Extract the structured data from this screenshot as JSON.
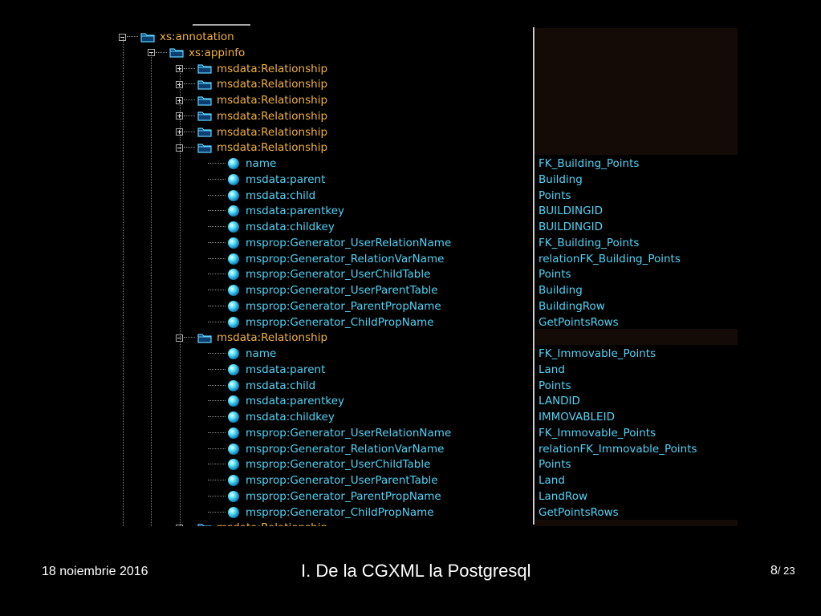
{
  "slide": {
    "date": "18 noiembrie 2016",
    "title": "I. De la CGXML la Postgresql",
    "page": "8",
    "total": "/ 23"
  },
  "tree": {
    "annotation": "xs:annotation",
    "appinfo": "xs:appinfo",
    "collapsed": [
      "msdata:Relationship",
      "msdata:Relationship",
      "msdata:Relationship",
      "msdata:Relationship",
      "msdata:Relationship"
    ],
    "rel1": {
      "label": "msdata:Relationship",
      "attrs": [
        {
          "name": "name",
          "value": "FK_Building_Points"
        },
        {
          "name": "msdata:parent",
          "value": "Building"
        },
        {
          "name": "msdata:child",
          "value": "Points"
        },
        {
          "name": "msdata:parentkey",
          "value": "BUILDINGID"
        },
        {
          "name": "msdata:childkey",
          "value": "BUILDINGID"
        },
        {
          "name": "msprop:Generator_UserRelationName",
          "value": "FK_Building_Points"
        },
        {
          "name": "msprop:Generator_RelationVarName",
          "value": "relationFK_Building_Points"
        },
        {
          "name": "msprop:Generator_UserChildTable",
          "value": "Points"
        },
        {
          "name": "msprop:Generator_UserParentTable",
          "value": "Building"
        },
        {
          "name": "msprop:Generator_ParentPropName",
          "value": "BuildingRow"
        },
        {
          "name": "msprop:Generator_ChildPropName",
          "value": "GetPointsRows"
        }
      ]
    },
    "rel2": {
      "label": "msdata:Relationship",
      "attrs": [
        {
          "name": "name",
          "value": "FK_Immovable_Points"
        },
        {
          "name": "msdata:parent",
          "value": "Land"
        },
        {
          "name": "msdata:child",
          "value": "Points"
        },
        {
          "name": "msdata:parentkey",
          "value": "LANDID"
        },
        {
          "name": "msdata:childkey",
          "value": "IMMOVABLEID"
        },
        {
          "name": "msprop:Generator_UserRelationName",
          "value": "FK_Immovable_Points"
        },
        {
          "name": "msprop:Generator_RelationVarName",
          "value": "relationFK_Immovable_Points"
        },
        {
          "name": "msprop:Generator_UserChildTable",
          "value": "Points"
        },
        {
          "name": "msprop:Generator_UserParentTable",
          "value": "Land"
        },
        {
          "name": "msprop:Generator_ParentPropName",
          "value": "LandRow"
        },
        {
          "name": "msprop:Generator_ChildPropName",
          "value": "GetPointsRows"
        }
      ]
    }
  }
}
